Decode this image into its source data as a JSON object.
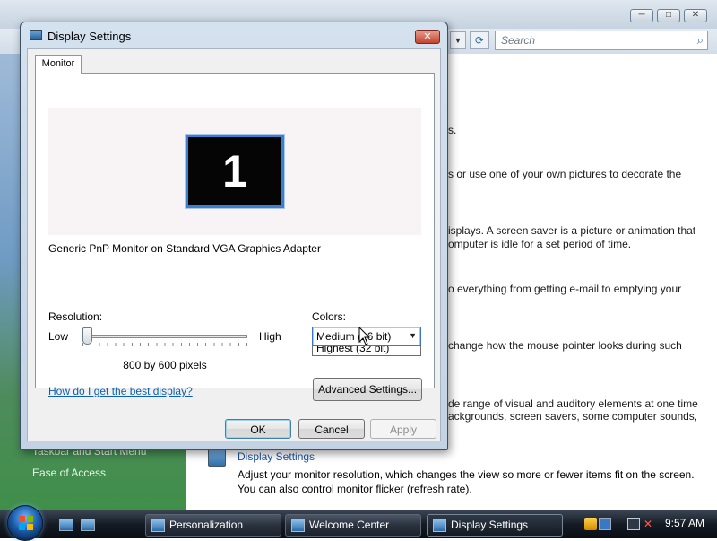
{
  "background_window": {
    "search_placeholder": "Search",
    "fragments": [
      "s.",
      "s or use one of your own pictures to decorate the",
      "isplays. A screen saver is a picture or animation that",
      "omputer is idle for a set period of time.",
      "o everything from getting e-mail to emptying your",
      "change how the mouse pointer looks during such",
      "de range of visual and auditory elements at one time",
      "ackgrounds, screen savers, some computer sounds,"
    ],
    "sidebar_links": [
      "Taskbar and Start Menu",
      "Ease of Access"
    ],
    "display_item": {
      "title": "Display Settings",
      "desc1": "Adjust your monitor resolution, which changes the view so more or fewer items fit on the screen.",
      "desc2": "You can also control monitor flicker (refresh rate)."
    }
  },
  "dialog": {
    "title": "Display Settings",
    "close_glyph": "✕",
    "tab": "Monitor",
    "monitor_number": "1",
    "monitor_description": "Generic PnP Monitor on Standard VGA Graphics Adapter",
    "resolution": {
      "label": "Resolution:",
      "low": "Low",
      "high": "High",
      "value_text": "800 by 600 pixels",
      "slider_position": 0.0
    },
    "colors": {
      "label": "Colors:",
      "selected": "Medium (16 bit)",
      "options_visible": [
        "Highest (32 bit)"
      ]
    },
    "help_link": "How do I get the best display?",
    "buttons": {
      "advanced": "Advanced Settings...",
      "ok": "OK",
      "cancel": "Cancel",
      "apply": "Apply"
    }
  },
  "taskbar": {
    "buttons": [
      {
        "label": "Personalization",
        "active": false
      },
      {
        "label": "Welcome Center",
        "active": false
      },
      {
        "label": "Display Settings",
        "active": true
      }
    ],
    "clock": "9:57 AM"
  }
}
